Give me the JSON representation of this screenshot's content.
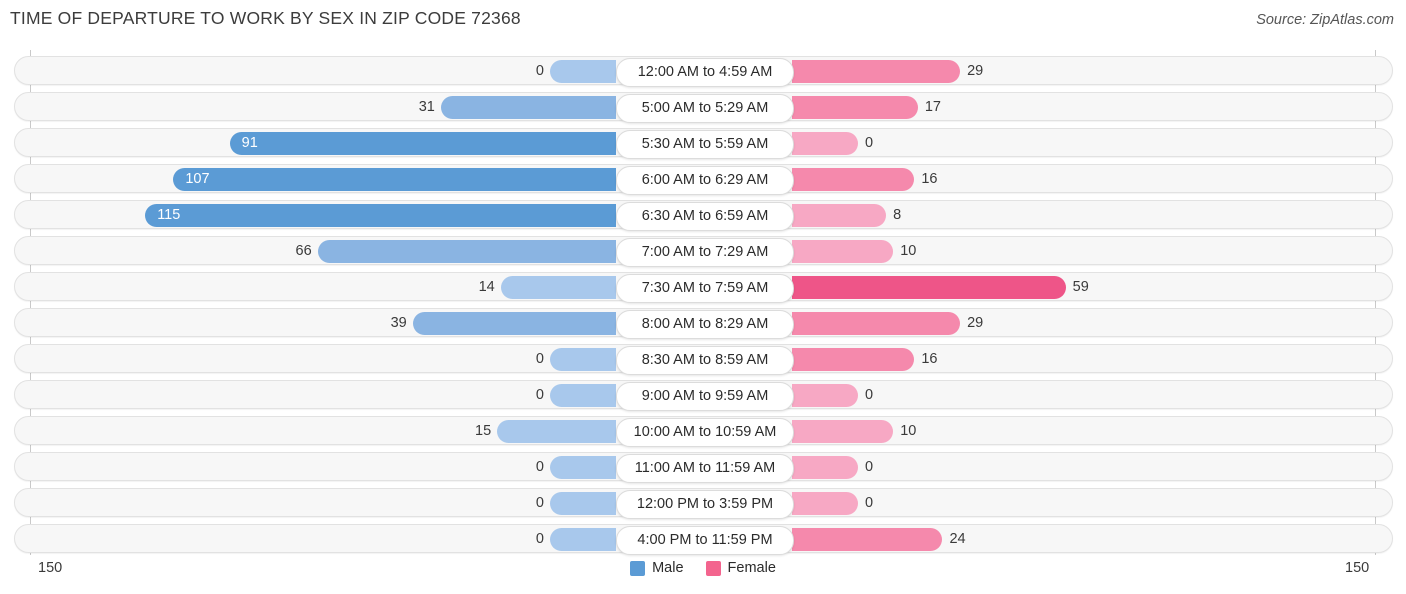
{
  "header": {
    "title": "TIME OF DEPARTURE TO WORK BY SEX IN ZIP CODE 72368",
    "source": "Source: ZipAtlas.com"
  },
  "axis": {
    "left_max_label": "150",
    "right_max_label": "150",
    "max": 150
  },
  "legend": {
    "items": [
      {
        "label": "Male",
        "color": "#5b9bd5"
      },
      {
        "label": "Female",
        "color": "#f3648e"
      }
    ]
  },
  "colors": {
    "male_light": "#a8c8ec",
    "male_mid": "#8ab4e2",
    "male_dark": "#5b9bd5",
    "female_light": "#f7a8c4",
    "female_mid": "#f589ac",
    "female_dark": "#ee5588",
    "track": "#f7f7f7",
    "track_border": "#e2e2e2"
  },
  "chart_data": {
    "type": "bar",
    "subtype": "diverging-bidirectional",
    "title": "TIME OF DEPARTURE TO WORK BY SEX IN ZIP CODE 72368",
    "xlabel": "",
    "ylabel": "",
    "xlim": [
      150,
      150
    ],
    "grid": false,
    "legend_position": "bottom-center",
    "categories": [
      "12:00 AM to 4:59 AM",
      "5:00 AM to 5:29 AM",
      "5:30 AM to 5:59 AM",
      "6:00 AM to 6:29 AM",
      "6:30 AM to 6:59 AM",
      "7:00 AM to 7:29 AM",
      "7:30 AM to 7:59 AM",
      "8:00 AM to 8:29 AM",
      "8:30 AM to 8:59 AM",
      "9:00 AM to 9:59 AM",
      "10:00 AM to 10:59 AM",
      "11:00 AM to 11:59 AM",
      "12:00 PM to 3:59 PM",
      "4:00 PM to 11:59 PM"
    ],
    "series": [
      {
        "name": "Male",
        "values": [
          0,
          31,
          91,
          107,
          115,
          66,
          14,
          39,
          0,
          0,
          15,
          0,
          0,
          0
        ]
      },
      {
        "name": "Female",
        "values": [
          29,
          17,
          0,
          16,
          8,
          10,
          59,
          29,
          16,
          0,
          10,
          0,
          0,
          24
        ]
      }
    ]
  }
}
